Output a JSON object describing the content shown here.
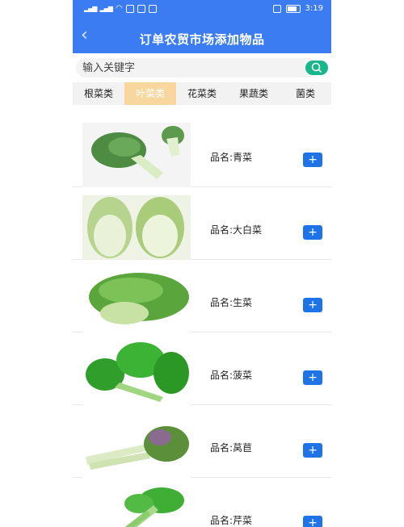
{
  "status_bar": {
    "time": "3:19"
  },
  "header": {
    "back_icon": "chevron-left-icon",
    "title": "订单农贸市场添加物品"
  },
  "search": {
    "placeholder": "输入关键字",
    "button_icon": "search-icon"
  },
  "tabs": [
    {
      "label": "根菜类",
      "active": false
    },
    {
      "label": "叶菜类",
      "active": true
    },
    {
      "label": "花菜类",
      "active": false
    },
    {
      "label": "果蔬类",
      "active": false
    },
    {
      "label": "菌类",
      "active": false
    }
  ],
  "items": [
    {
      "name": "品名:青菜",
      "add_label": "+"
    },
    {
      "name": "品名:大白菜",
      "add_label": "+"
    },
    {
      "name": "品名:生菜",
      "add_label": "+"
    },
    {
      "name": "品名:菠菜",
      "add_label": "+"
    },
    {
      "name": "品名:莴苣",
      "add_label": "+"
    },
    {
      "name": "品名:芹菜",
      "add_label": "+"
    }
  ],
  "colors": {
    "header": "#3b7cf2",
    "tab_active": "#f7d79d",
    "add_button": "#1e74e6",
    "search_button": "#19b68b"
  }
}
